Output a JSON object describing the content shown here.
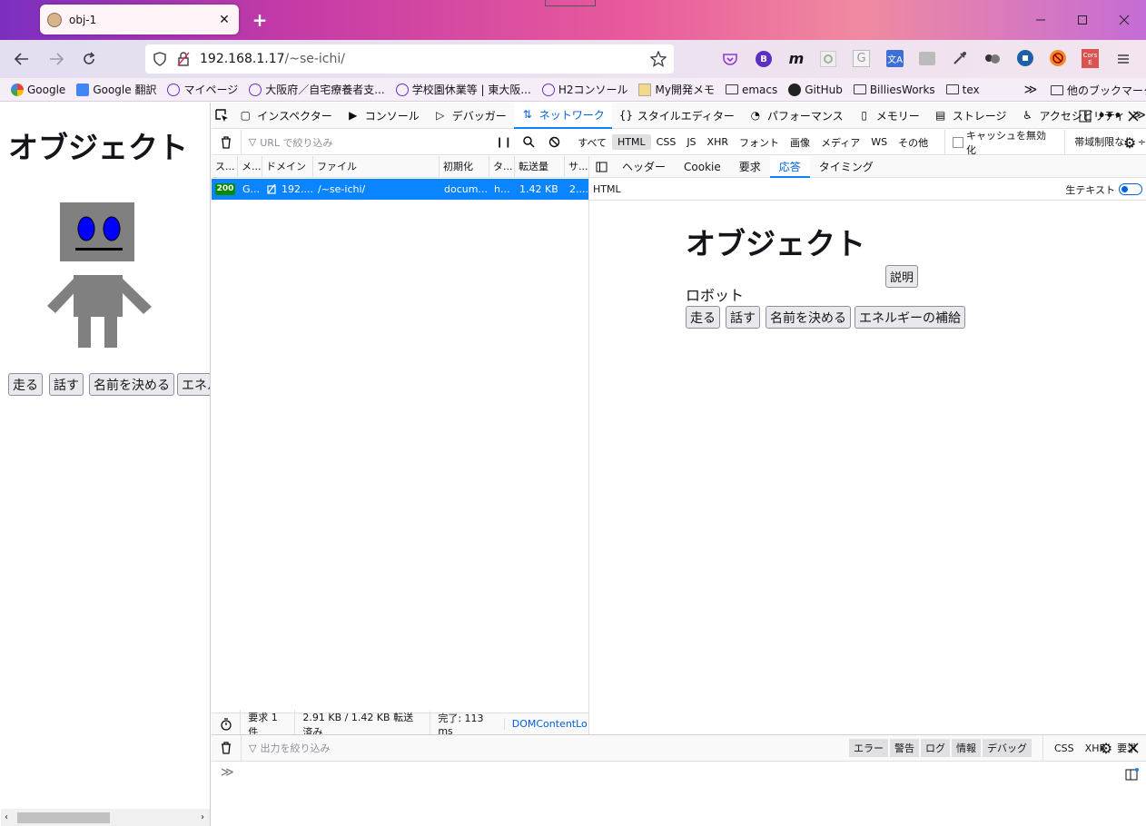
{
  "browser": {
    "tab_title": "obj-1",
    "tab_close": "✕",
    "new_tab": "+",
    "window_controls": {
      "minimize": "—",
      "maximize": "☐",
      "close": "✕"
    },
    "url_host": "192.168.1.17",
    "url_path": "/~se-ichi/"
  },
  "bookmarks": [
    {
      "label": "Google",
      "icon": "google-icon"
    },
    {
      "label": "Google 翻訳",
      "icon": "translate-icon"
    },
    {
      "label": "マイページ",
      "icon": "globe-icon"
    },
    {
      "label": "大阪府／自宅療養者支...",
      "icon": "globe-icon"
    },
    {
      "label": "学校園休業等 | 東大阪...",
      "icon": "globe-icon"
    },
    {
      "label": "H2コンソール",
      "icon": "globe-icon"
    },
    {
      "label": "My開発メモ",
      "icon": "memo-icon"
    },
    {
      "label": "emacs",
      "icon": "folder-icon"
    },
    {
      "label": "GitHub",
      "icon": "github-icon"
    },
    {
      "label": "BilliesWorks",
      "icon": "folder-icon"
    },
    {
      "label": "tex",
      "icon": "folder-icon"
    }
  ],
  "bookmarks_overflow": "≫",
  "other_bookmarks": "他のブックマーク",
  "page": {
    "heading": "オブジェクト",
    "buttons": [
      "走る",
      "話す",
      "名前を決める",
      "エネル"
    ]
  },
  "devtools": {
    "tabs": [
      {
        "label": "インスペクター",
        "icon": "inspector-icon"
      },
      {
        "label": "コンソール",
        "icon": "console-icon"
      },
      {
        "label": "デバッガー",
        "icon": "debugger-icon"
      },
      {
        "label": "ネットワーク",
        "icon": "network-icon"
      },
      {
        "label": "スタイルエディター",
        "icon": "braces-icon"
      },
      {
        "label": "パフォーマンス",
        "icon": "performance-icon"
      },
      {
        "label": "メモリー",
        "icon": "memory-icon"
      },
      {
        "label": "ストレージ",
        "icon": "storage-icon"
      },
      {
        "label": "アクセシビリティ",
        "icon": "accessibility-icon"
      }
    ],
    "url_filter_placeholder": "URL で絞り込み",
    "type_filters": [
      "すべて",
      "HTML",
      "CSS",
      "JS",
      "XHR",
      "フォント",
      "画像",
      "メディア",
      "WS",
      "その他"
    ],
    "type_filter_selected": "HTML",
    "disable_cache": "キャッシュを無効化",
    "throttle": "帯域制限なし ÷",
    "columns": [
      "ス...",
      "メ...",
      "ドメイン",
      "ファイル",
      "初期化",
      "タ...",
      "転送量",
      "サ..."
    ],
    "request": {
      "status": "200",
      "method": "G...",
      "domain": "192....",
      "file": "/~se-ichi/",
      "initiator": "docum...",
      "type": "h...",
      "transferred": "1.42 KB",
      "size": "2...."
    },
    "footer": {
      "requests": "要求 1 件",
      "transfer": "2.91 KB / 1.42 KB 転送済み",
      "finish": "完了: 113 ms",
      "dom": "DOMContentLo"
    },
    "side_tabs": [
      "ヘッダー",
      "Cookie",
      "要求",
      "応答",
      "タイミング"
    ],
    "side_tab_selected": "応答",
    "html_label": "HTML",
    "raw_text": "生テキスト",
    "preview": {
      "heading": "オブジェクト",
      "explain_button": "説明",
      "label": "ロボット",
      "buttons": [
        "走る",
        "話す",
        "名前を決める",
        "エネルギーの補給"
      ]
    },
    "console": {
      "filter_placeholder": "出力を絞り込み",
      "levels": [
        "エラー",
        "警告",
        "ログ",
        "情報",
        "デバッグ"
      ],
      "extra": [
        "CSS",
        "XHR",
        "要求"
      ],
      "prompt": "≫"
    }
  },
  "colors": {
    "accent": "#0a84ff",
    "status_ok": "#058b00",
    "robot_gray": "#808080",
    "robot_eye": "#0000ff"
  }
}
